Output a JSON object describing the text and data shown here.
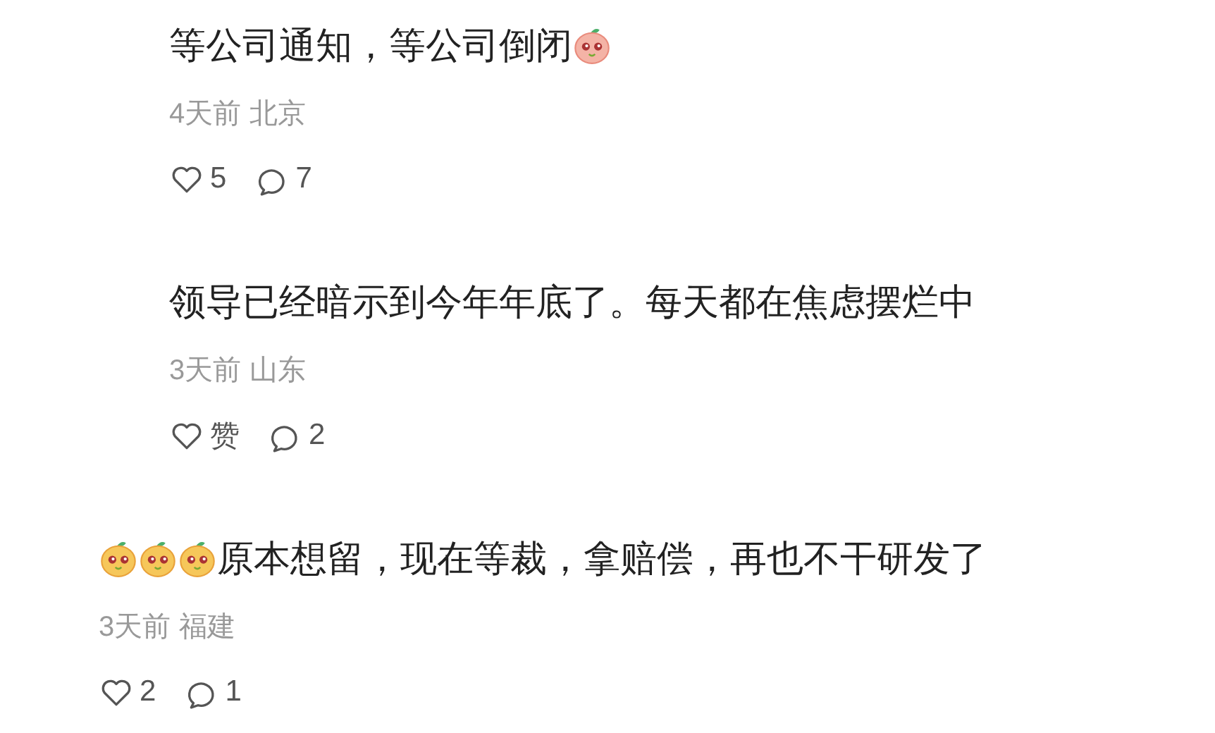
{
  "comments": [
    {
      "kind": "reply",
      "parts": [
        {
          "kind": "text",
          "text": "等公司通知，等公司倒闭"
        },
        {
          "kind": "peach"
        }
      ],
      "time": "4天前",
      "location": "北京",
      "likes": "5",
      "replies": "7"
    },
    {
      "kind": "reply",
      "parts": [
        {
          "kind": "text",
          "text": "领导已经暗示到今年年底了。每天都在焦虑摆烂中"
        }
      ],
      "time": "3天前",
      "location": "山东",
      "likes": "赞",
      "replies": "2"
    },
    {
      "kind": "comment",
      "parts": [
        {
          "kind": "mango"
        },
        {
          "kind": "mango"
        },
        {
          "kind": "mango"
        },
        {
          "kind": "text",
          "text": "原本想留，现在等裁，拿赔偿，再也不干研发了"
        }
      ],
      "time": "3天前",
      "location": "福建",
      "likes": "2",
      "replies": "1"
    }
  ]
}
